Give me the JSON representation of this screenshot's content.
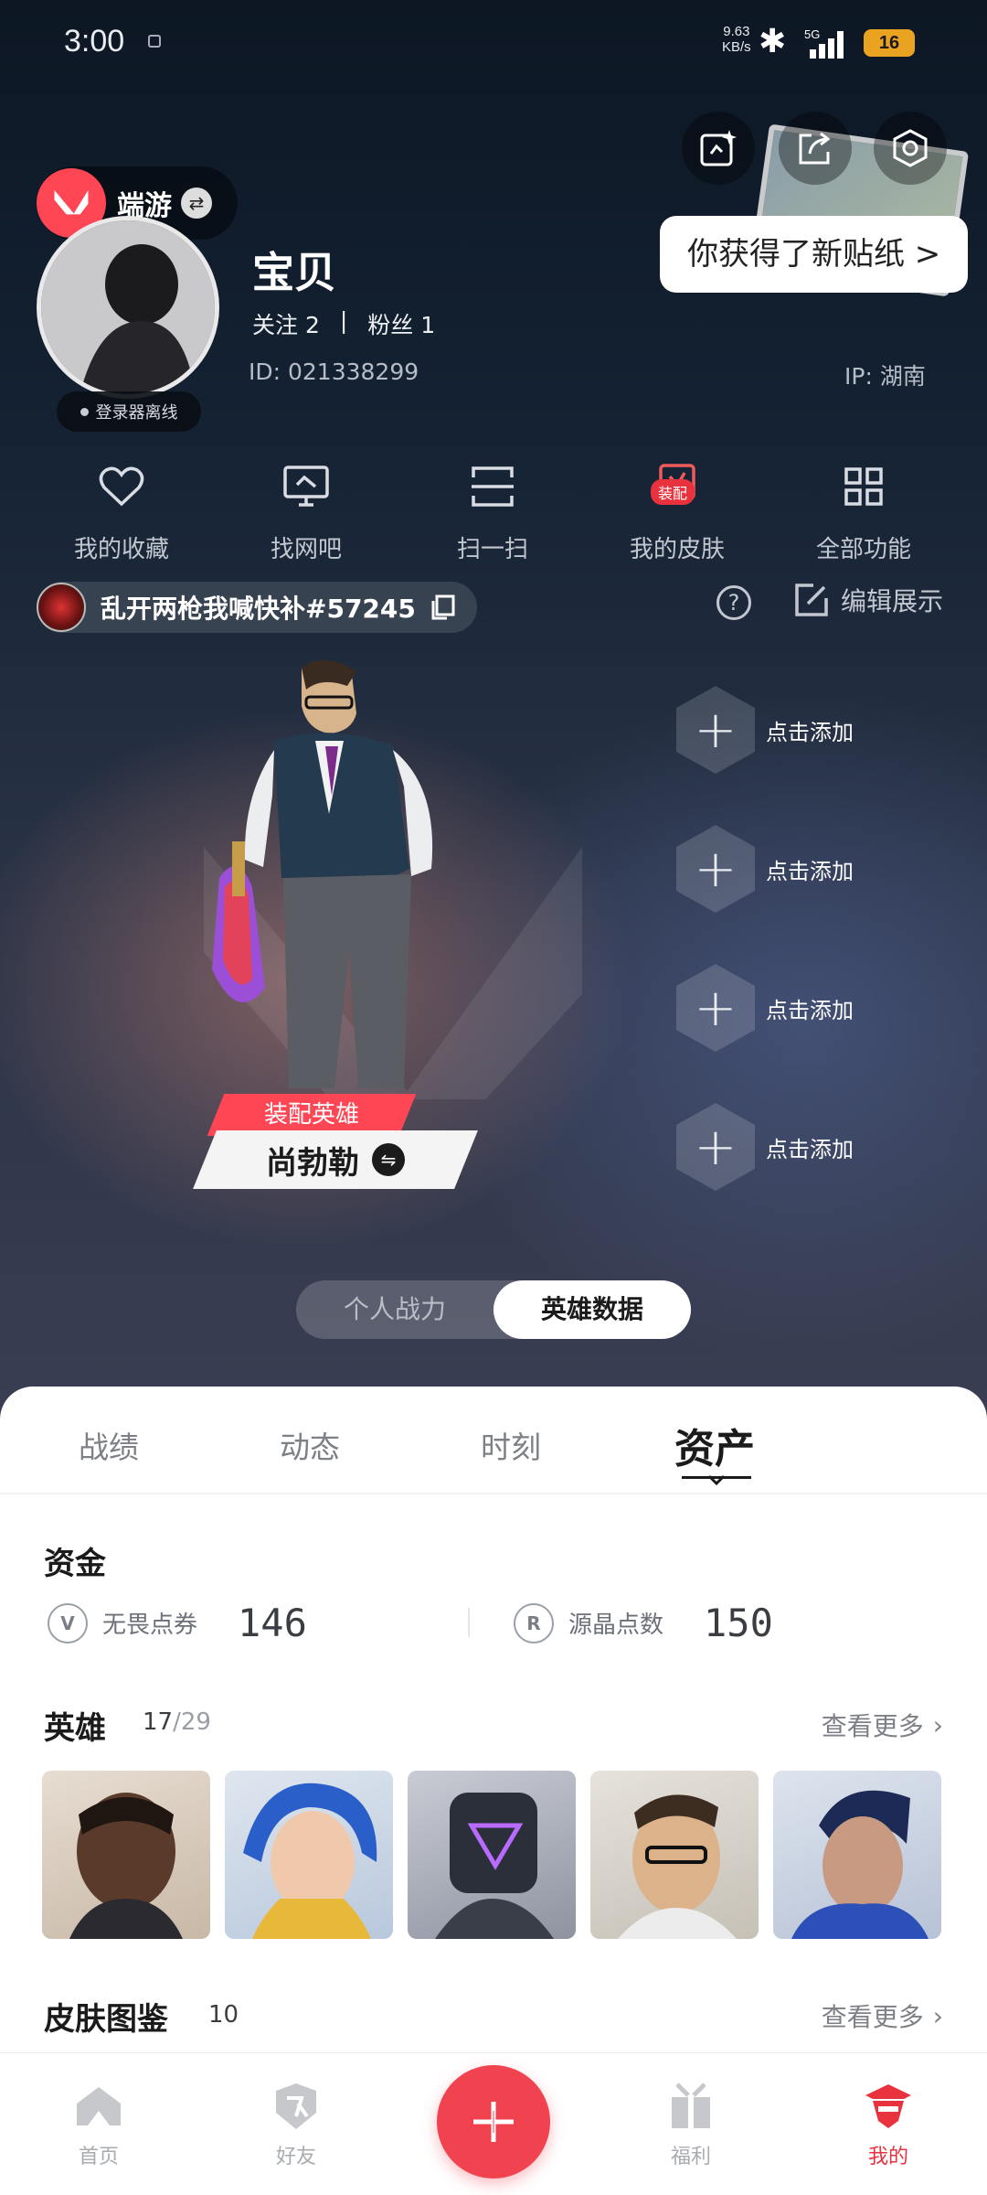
{
  "status_bar": {
    "time": "3:00",
    "net_speed": "9.63",
    "net_unit": "KB/s",
    "signal_label": "5G",
    "battery": "16"
  },
  "profile": {
    "game_label": "端游",
    "nickname": "宝贝",
    "follow_label": "关注 2",
    "fans_label": "粉丝 1",
    "separator": "|",
    "id_text": "ID: 021338299",
    "ip_text": "IP: 湖南",
    "offline_status": "登录器离线",
    "sticker_tip": "你获得了新贴纸 >"
  },
  "shortcuts": [
    {
      "label": "我的收藏",
      "icon": "heart-icon"
    },
    {
      "label": "找网吧",
      "icon": "monitor-icon"
    },
    {
      "label": "扫一扫",
      "icon": "scan-icon"
    },
    {
      "label": "我的皮肤",
      "icon": "skin-icon",
      "badge": "装配"
    },
    {
      "label": "全部功能",
      "icon": "grid-icon"
    }
  ],
  "player": {
    "tag": "乱开两枪我喊快补#57245",
    "edit_label": "编辑展示"
  },
  "showcase": {
    "equipped_label": "装配英雄",
    "agent_name": "尚勃勒",
    "add_slot_label": "点击添加",
    "toggle": [
      "个人战力",
      "英雄数据"
    ]
  },
  "tabs": [
    "战绩",
    "动态",
    "时刻",
    "资产"
  ],
  "assets": {
    "funds_title": "资金",
    "vp_label": "无畏点券",
    "vp_value": "146",
    "rp_label": "源晶点数",
    "rp_value": "150",
    "agents_title": "英雄",
    "agents_owned": "17",
    "agents_sep": "/",
    "agents_total": "29",
    "skins_title": "皮肤图鉴",
    "skins_count": "10",
    "see_more": "查看更多"
  },
  "nav": [
    {
      "label": "首页",
      "icon": "home-icon"
    },
    {
      "label": "好友",
      "icon": "friends-icon"
    },
    {
      "label": "福利",
      "icon": "gift-icon"
    },
    {
      "label": "我的",
      "icon": "profile-icon"
    }
  ],
  "colors": {
    "accent": "#fe4655",
    "hero_dark": "#142233",
    "active_nav": "#e8323e"
  }
}
